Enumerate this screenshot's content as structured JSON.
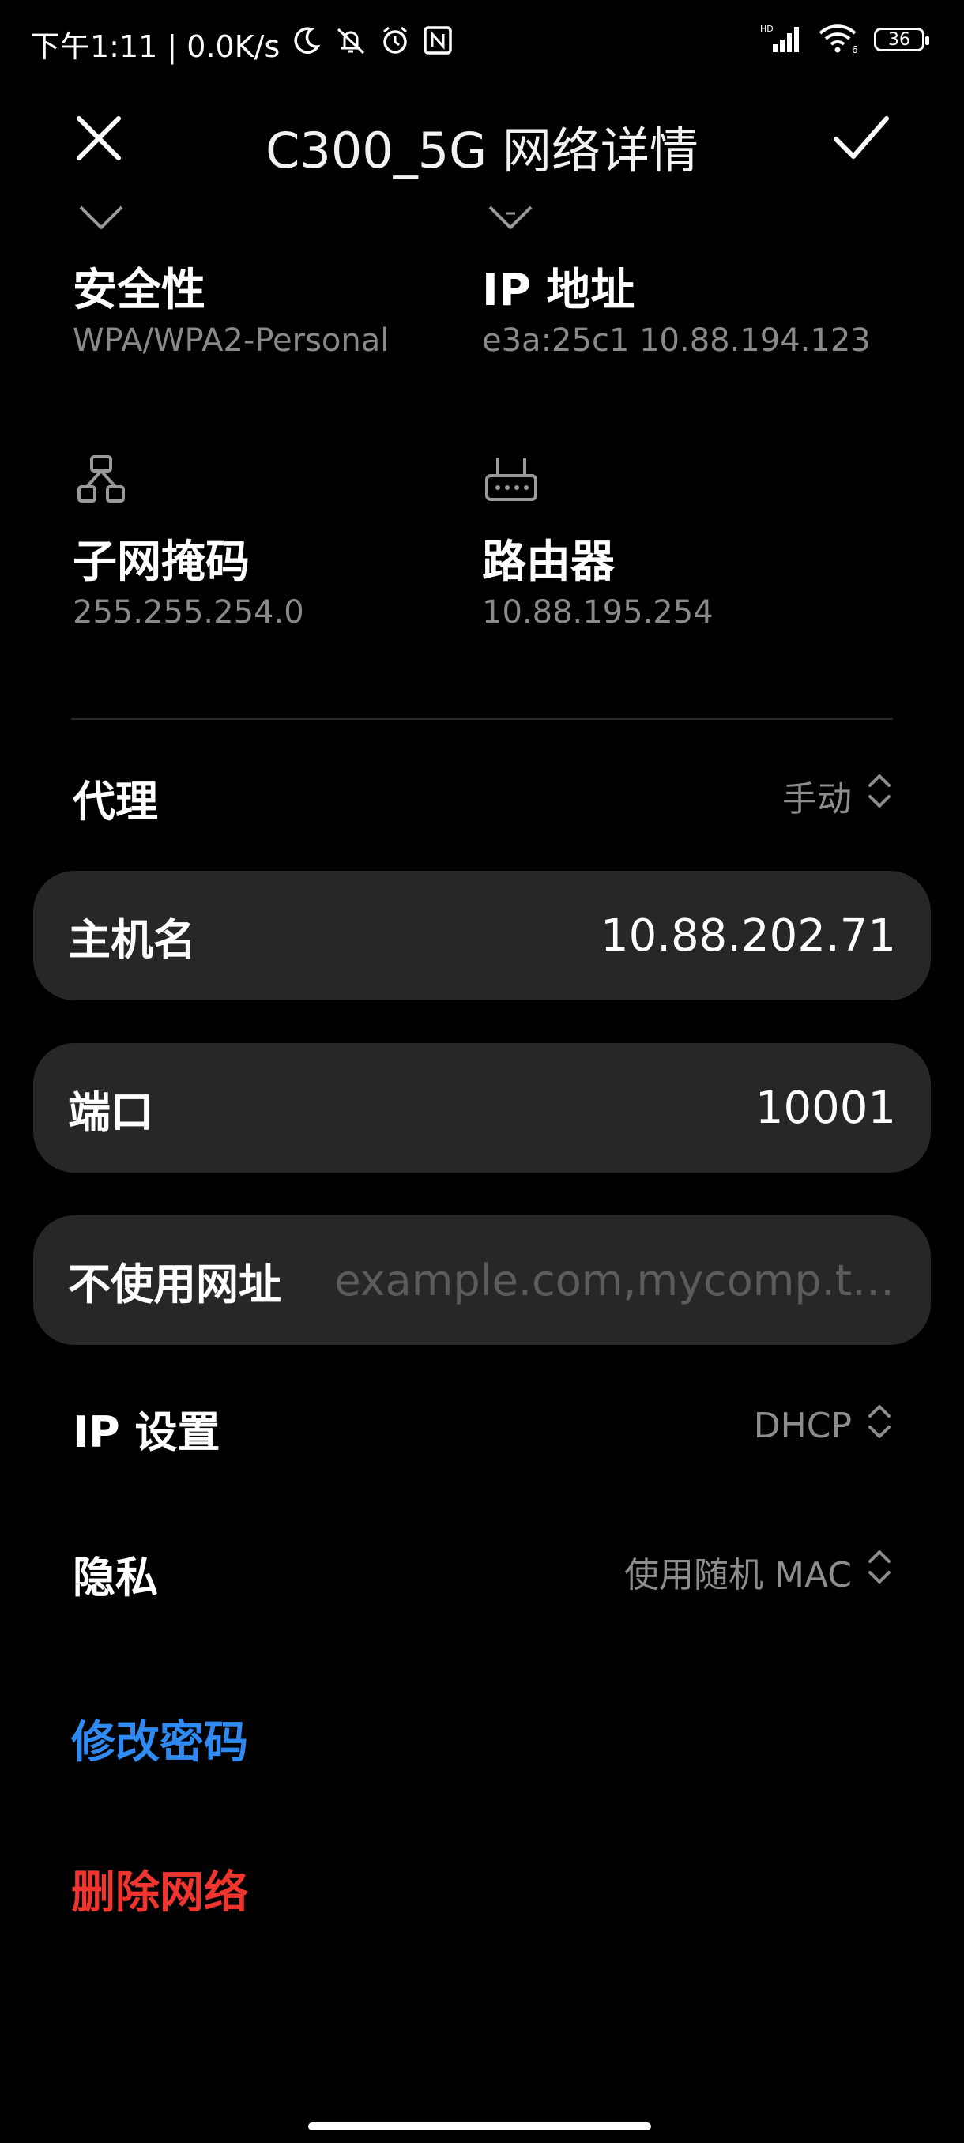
{
  "status_bar": {
    "time_speed": "下午1:11 | 0.0K/s",
    "hd_label": "HD",
    "wifi_label": "6",
    "battery": "36"
  },
  "header": {
    "title": "C300_5G 网络详情",
    "close_icon": "close-icon",
    "confirm_icon": "check-icon"
  },
  "info": {
    "security": {
      "title": "安全性",
      "value": "WPA/WPA2-Personal",
      "icon": "shield-icon"
    },
    "ip": {
      "title": "IP 地址",
      "value": "e3a:25c1 10.88.194.123",
      "icon": "shield-icon"
    },
    "subnet": {
      "title": "子网掩码",
      "value": "255.255.254.0",
      "icon": "network-tree-icon"
    },
    "router": {
      "title": "路由器",
      "value": "10.88.195.254",
      "icon": "router-icon"
    }
  },
  "proxy": {
    "label": "代理",
    "value": "手动"
  },
  "hostname": {
    "label": "主机名",
    "value": "10.88.202.71"
  },
  "port": {
    "label": "端口",
    "value": "10001"
  },
  "bypass": {
    "label": "不使用网址",
    "placeholder": "example.com,mycomp.t…"
  },
  "ip_settings": {
    "label": "IP 设置",
    "value": "DHCP"
  },
  "privacy": {
    "label": "隐私",
    "value": "使用随机 MAC"
  },
  "actions": {
    "change_password": "修改密码",
    "delete_network": "删除网络"
  },
  "colors": {
    "background": "#000000",
    "card": "#272727",
    "link_blue": "#2f8bf3",
    "link_red": "#f0352f"
  }
}
